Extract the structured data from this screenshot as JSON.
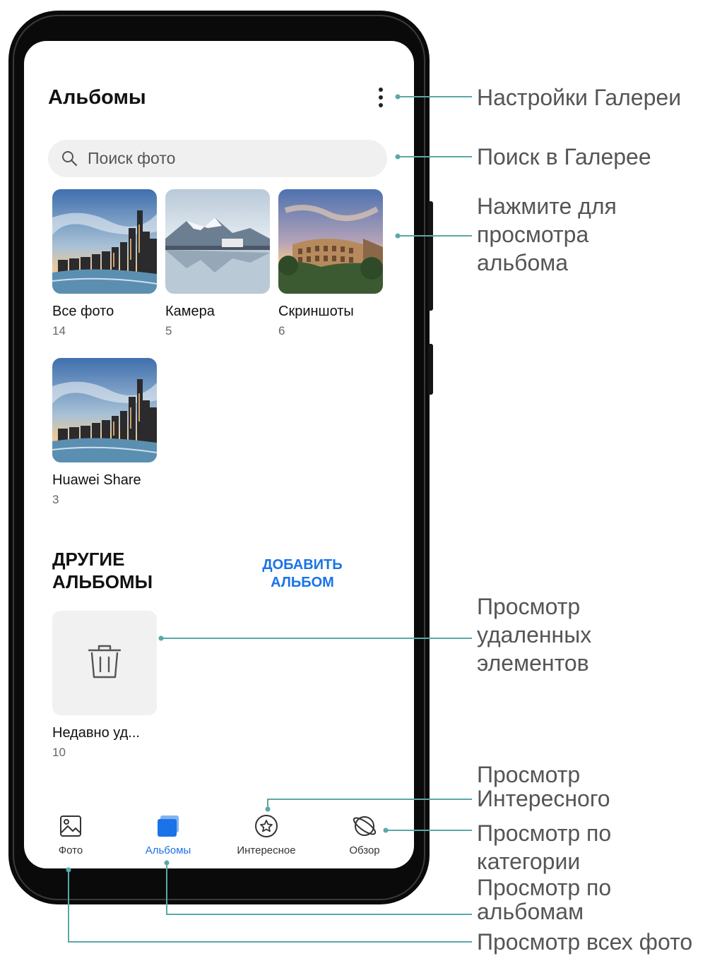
{
  "screen": {
    "title": "Альбомы",
    "search": {
      "placeholder": "Поиск фото"
    },
    "albums": [
      {
        "name": "Все фото",
        "count": "14"
      },
      {
        "name": "Камера",
        "count": "5"
      },
      {
        "name": "Скриншоты",
        "count": "6"
      },
      {
        "name": "Huawei Share",
        "count": "3"
      }
    ],
    "other_section": {
      "title": "ДРУГИЕ АЛЬБОМЫ",
      "add_button": "ДОБАВИТЬ АЛЬБОМ",
      "trash": {
        "name": "Недавно уд...",
        "count": "10"
      }
    },
    "nav": [
      {
        "label": "Фото",
        "icon": "image-icon"
      },
      {
        "label": "Альбомы",
        "icon": "albums-icon",
        "active": true
      },
      {
        "label": "Интересное",
        "icon": "star-circle-icon"
      },
      {
        "label": "Обзор",
        "icon": "planet-icon"
      }
    ],
    "accent_color": "#1a73e8"
  },
  "callouts": {
    "settings": "Настройки Галереи",
    "search": "Поиск в Галерее",
    "view_album": "Нажмите для\nпросмотра\nальбома",
    "deleted": "Просмотр\nудаленных\nэлементов",
    "discover": "Просмотр\nИнтересного",
    "category": "Просмотр по\nкатегории",
    "by_album": "Просмотр по\nальбомам",
    "all_photos": "Просмотр всех фото"
  }
}
